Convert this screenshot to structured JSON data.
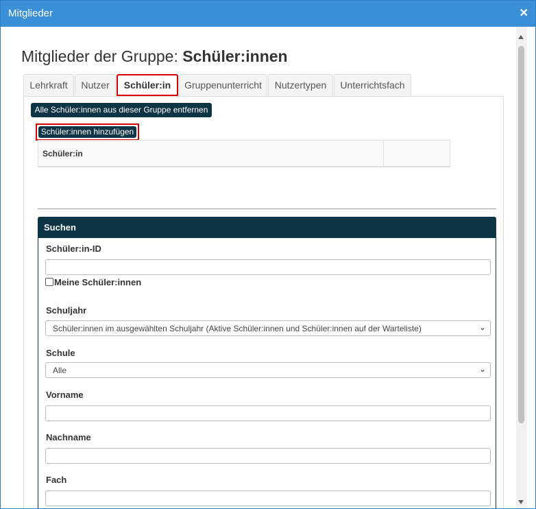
{
  "window": {
    "title": "Mitglieder",
    "close_icon": "close-icon"
  },
  "heading": {
    "prefix": "Mitglieder der Gruppe: ",
    "group_name": "Schüler:innen"
  },
  "tabs": [
    {
      "label": "Lehrkraft"
    },
    {
      "label": "Nutzer"
    },
    {
      "label": "Schüler:in",
      "active": true
    },
    {
      "label": "Gruppenunterricht"
    },
    {
      "label": "Nutzertypen"
    },
    {
      "label": "Unterrichtsfach"
    }
  ],
  "actions": {
    "remove_all_label": "Alle Schüler:innen aus dieser Gruppe entfernen",
    "add_label": "Schüler:innen hinzufügen"
  },
  "members_table": {
    "columns": [
      "Schüler:in",
      ""
    ]
  },
  "search": {
    "header": "Suchen",
    "student_id": {
      "label": "Schüler:in-ID",
      "value": ""
    },
    "my_students": {
      "label": "Meine Schüler:innen",
      "checked": false
    },
    "school_year": {
      "label": "Schuljahr",
      "selected": "Schüler:innen im ausgewählten Schuljahr (Aktive Schüler:innen und Schüler:innen auf der Warteliste)"
    },
    "school": {
      "label": "Schule",
      "selected": "Alle"
    },
    "first_name": {
      "label": "Vorname",
      "value": ""
    },
    "last_name": {
      "label": "Nachname",
      "value": ""
    },
    "subject": {
      "label": "Fach",
      "value": ""
    }
  },
  "colors": {
    "titlebar": "#3a8fd6",
    "dark_button": "#0d3545",
    "highlight": "#d90000"
  }
}
